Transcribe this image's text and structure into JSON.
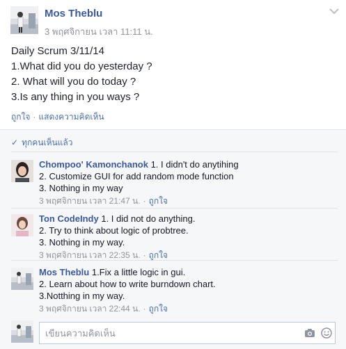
{
  "post": {
    "author": "Mos Theblu",
    "timestamp": "3 พฤศจิกายน เวลา 11:11 น.",
    "text": "Daily Scrum 3/11/14\n1.What did you do yesterday ?\n2. What will you do today ?\n3.Is any thing in you ways ?",
    "actions": {
      "like": "ถูกใจ",
      "comment": "แสดงความคิดเห็น"
    }
  },
  "seen_by": "ทุกคนเห็นแล้ว",
  "comments": [
    {
      "author": "Chompoo' Kamonchanok",
      "text_first": "1. I didn't do anytihing",
      "text_rest": "2. Customize GUI for add random mode function\n3. Nothing in my way",
      "timestamp": "3 พฤศจิกายน เวลา 21:47 น.",
      "like": "ถูกใจ"
    },
    {
      "author": "Ton CodeIndy",
      "text_first": "1. I did not do anything.",
      "text_rest": "2. Try to think about logic of probtree.\n3. Nothing in my way.",
      "timestamp": "3 พฤศจิกายน เวลา 22:35 น.",
      "like": "ถูกใจ"
    },
    {
      "author": "Mos Theblu",
      "text_first": "1.Fix a little logic in gui.",
      "text_rest": "2. Learn about how to write burndown chart.\n3.Notthing in my way.",
      "timestamp": "3 พฤศจิกายน เวลา 22:44 น.",
      "like": "ถูกใจ"
    }
  ],
  "composer": {
    "placeholder": "เขียนความคิดเห็น"
  },
  "colors": {
    "link": "#3b5998",
    "meta": "#90949c",
    "background": "#f6f7f9"
  },
  "icons": [
    "chevron-down-icon",
    "check-icon",
    "camera-icon",
    "emoji-icon"
  ]
}
